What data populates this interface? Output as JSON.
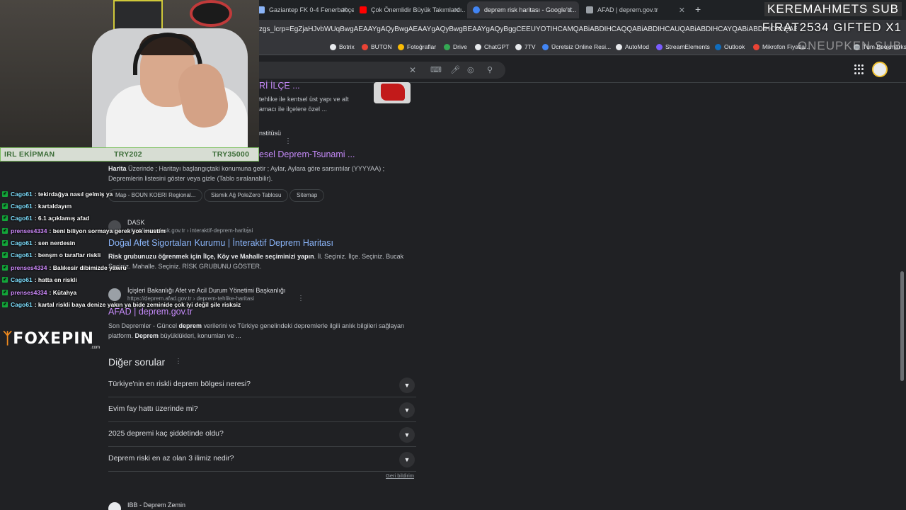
{
  "browser": {
    "tabs": [
      {
        "label": "Gaziantep FK 0-4 Fenerbahçe - ...",
        "color": "#8ab4f8"
      },
      {
        "label": "Çok Önemlidir Büyük Takımlardı...",
        "color": "#ff0000"
      },
      {
        "label": "deprem risk haritası - Google'd...",
        "color": "#4285f4"
      },
      {
        "label": "AFAD | deprem.gov.tr",
        "color": "#9aa0a6"
      }
    ],
    "new_tab": "+",
    "url": "zgs_lcrp=EgZjaHJvbWUqBwgAEAAYgAQyBwgAEAAYgAQyBwgBEAAYgAQyBggCEEUYOTIHCAMQABiABDIHCAQQABiABDIHCAUQABiABDIHCAYQABiABDIHCAcQABiABDIHCAgQABiABDIHCAkQABiABNIBCDM",
    "bookmarks": [
      {
        "label": "Botrix",
        "color": "#e8eaed"
      },
      {
        "label": "BUTON",
        "color": "#ea4335"
      },
      {
        "label": "Fotoğraflar",
        "color": "#fbbc04"
      },
      {
        "label": "Drive",
        "color": "#34a853"
      },
      {
        "label": "ChatGPT",
        "color": "#e8eaed"
      },
      {
        "label": "7TV",
        "color": "#e8eaed"
      },
      {
        "label": "Ücretsiz Online Resi...",
        "color": "#4285f4"
      },
      {
        "label": "AutoMod",
        "color": "#e8eaed"
      },
      {
        "label": "StreamElements",
        "color": "#7a5cff"
      },
      {
        "label": "Outlook",
        "color": "#0f6cbd"
      },
      {
        "label": "Mikrofon Fiyatla...",
        "color": "#ea4335"
      },
      {
        "label": "Tüm Bookmarks",
        "color": "#9aa0a6"
      }
    ]
  },
  "results": {
    "r1": {
      "title": "Rİ İLÇE ...",
      "snippet_line1": "tehlike ile kentsel üst yapı ve alt",
      "snippet_line2": "amacı ile ilçelere özel ..."
    },
    "r2": {
      "site": "nstitüsü",
      "title": "esel Deprem-Tsunami ...",
      "snippet_bold": "Harita",
      "snippet_line1": " Üzerinde ; Haritayı başlangıçtaki konumuna getir ; Aylar, Aylara göre sarsıntılar (YYYYAA) ;",
      "snippet_line2": "Depremlerin listesini göster veya gizle (Tablo sıralanabilir).",
      "sitelinks": [
        "Map - BOUN KOERI Regional...",
        "Sismik Ağ PoleZero Tablosu",
        "Sitemap"
      ]
    },
    "r3": {
      "site": "DASK",
      "cite": "https://www.dask.gov.tr › interaktif-deprem-haritasi",
      "title": "Doğal Afet Sigortaları Kurumu | İnteraktif Deprem Haritası",
      "snippet_b1": "Risk grubunuzu öğrenmek için İlçe, Köy ve Mahalle seçiminizi yapın",
      "snippet_t1": ". İl. Seçiniz. İlçe. Seçiniz. Bucak",
      "snippet_line2": "Seçiniz. Mahalle. Seçiniz. RİSK GRUBUNU GÖSTER."
    },
    "r4": {
      "site": "İçişleri Bakanlığı Afet ve Acil Durum Yönetimi Başkanlığı",
      "cite": "https://deprem.afad.gov.tr › deprem-tehlike-haritasi",
      "title": "AFAD | deprem.gov.tr",
      "snippet_t1": "Son Depremler - Güncel ",
      "snippet_b1": "deprem",
      "snippet_t2": " verilerini ve Türkiye genelindeki depremlerle ilgili anlık bilgileri sağlayan",
      "snippet_t3": "platform. ",
      "snippet_b2": "Deprem",
      "snippet_t4": " büyüklükleri, konumları ve ..."
    },
    "r5": {
      "site": "IBB - Deprem Zemin"
    }
  },
  "paa": {
    "title": "Diğer sorular",
    "questions": [
      "Türkiye'nin en riskli deprem bölgesi neresi?",
      "Evim fay hattı üzerinde mi?",
      "2025 depremi kaç şiddetinde oldu?",
      "Deprem riski en az olan 3 ilimiz nedir?"
    ],
    "feedback": "Geri bildirim"
  },
  "stream": {
    "donation_bar": {
      "left": "IRL EKİPMAN",
      "mid": "TRY202",
      "right": "TRY35000"
    },
    "chat": [
      {
        "user": "Cago61",
        "msg": ": tekirdağya nasıl gelmiş ya",
        "color": "#7fe0ff"
      },
      {
        "user": "Cago61",
        "msg": ": kartaldayım",
        "color": "#7fe0ff"
      },
      {
        "user": "Cago61",
        "msg": ": 6.1 açıklamış afad",
        "color": "#7fe0ff"
      },
      {
        "user": "prenses4334",
        "msg": ": beni biliyon sormaya gerek yok mustim",
        "color": "#d18cff"
      },
      {
        "user": "Cago61",
        "msg": ": sen nerdesin",
        "color": "#7fe0ff"
      },
      {
        "user": "Cago61",
        "msg": ": benşm o taraflar riskli",
        "color": "#7fe0ff"
      },
      {
        "user": "prenses4334",
        "msg": ": Balıkesir dibimizde yawru",
        "color": "#d18cff"
      },
      {
        "user": "Cago61",
        "msg": ": hatta en riskli",
        "color": "#7fe0ff"
      },
      {
        "user": "prenses4334",
        "msg": ": Kütahya",
        "color": "#d18cff"
      },
      {
        "user": "Cago61",
        "msg": ": kartal riskli baya denize yakın ya bide zeminide çok iyi değil şile risksiz",
        "color": "#7fe0ff"
      }
    ],
    "brand_name": "FOXEPIN",
    "brand_domain": ".com",
    "sub_alerts": [
      "KEREMAHMETS SUB",
      "FIRAT2534 GIFTED X1",
      "ONEUPKEN SUB"
    ]
  }
}
